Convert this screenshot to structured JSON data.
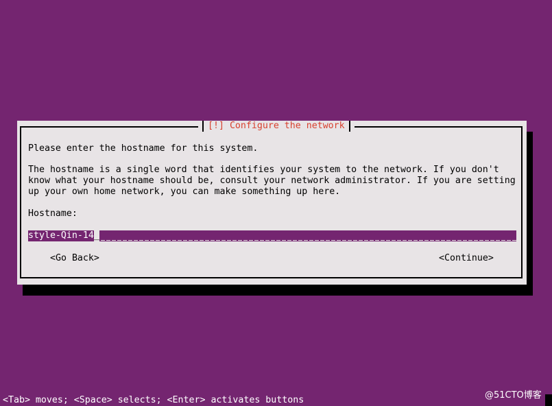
{
  "dialog": {
    "title": "[!] Configure the network",
    "prompt": "Please enter the hostname for this system.",
    "description_lines": [
      "The hostname is a single word that identifies your system to the network. If you don't",
      "know what your hostname should be, consult your network administrator. If you are setting",
      "up your own home network, you can make something up here."
    ],
    "field_label": "Hostname:",
    "hostname_value": "style-Qin-14",
    "cursor": "_",
    "buttons": {
      "go_back": "<Go Back>",
      "continue": "<Continue>"
    }
  },
  "footer": {
    "help": "<Tab> moves; <Space> selects; <Enter> activates buttons"
  },
  "watermark": "@51CTO博客",
  "colors": {
    "background": "#742570",
    "dialog_bg": "#e8e4e6",
    "title": "#d8412f",
    "field_highlight": "#742570"
  }
}
